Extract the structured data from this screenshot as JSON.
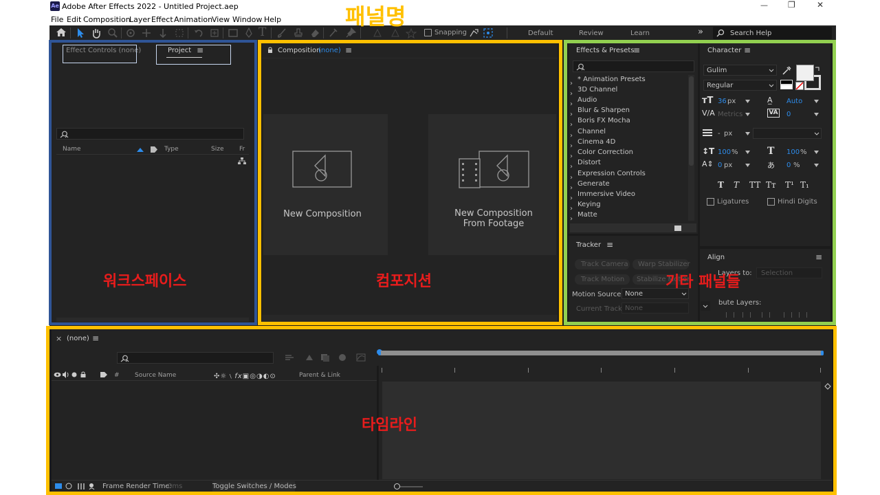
{
  "window": {
    "title": "Adobe After Effects 2022 - Untitled Project.aep",
    "logo": "Ae",
    "controls": [
      "—",
      "❐",
      "✕"
    ]
  },
  "menu": [
    "File",
    "Edit",
    "Composition",
    "Layer",
    "Effect",
    "Animation",
    "View",
    "Window",
    "Help"
  ],
  "toolbar": {
    "snapping_label": "Snapping",
    "workspaces": [
      "Default",
      "Review",
      "Learn"
    ],
    "overflow": "»",
    "search_help": "Search Help"
  },
  "annotations": {
    "panel_name": "패널명",
    "workspace": "워크스페이스",
    "composition": "컴포지션",
    "other_panels": "기타 패널들",
    "timeline": "타임라인"
  },
  "left_panel": {
    "effect_controls_tab": "Effect Controls (none)",
    "project_tab": "Project",
    "menu": "≡",
    "columns": {
      "name": "Name",
      "type": "Type",
      "size": "Size",
      "frame": "Fr"
    }
  },
  "composition_panel": {
    "tab_prefix": "Composition",
    "tab_value": "(none)",
    "menu": "≡",
    "new_comp": "New Composition",
    "new_comp_footage_1": "New Composition",
    "new_comp_footage_2": "From Footage"
  },
  "effects_panel": {
    "title": "Effects & Presets",
    "menu": "≡",
    "items": [
      "* Animation Presets",
      "3D Channel",
      "Audio",
      "Blur & Sharpen",
      "Boris FX Mocha",
      "Channel",
      "Cinema 4D",
      "Color Correction",
      "Distort",
      "Expression Controls",
      "Generate",
      "Immersive Video",
      "Keying",
      "Matte"
    ]
  },
  "tracker_panel": {
    "title": "Tracker",
    "menu": "≡",
    "track_camera": "Track Camera",
    "warp_stabilizer": "Warp Stabilizer",
    "track_motion": "Track Motion",
    "stabilize_motion": "Stabilize Motion",
    "motion_source_label": "Motion Source:",
    "motion_source_value": "None",
    "current_track_label": "Current Track:",
    "current_track_value": "None"
  },
  "character_panel": {
    "title": "Character",
    "menu": "≡",
    "font": "Gulim",
    "style": "Regular",
    "font_size": "36",
    "font_size_unit": "px",
    "leading": "Auto",
    "kerning": "Metrics",
    "tracking": "0",
    "stroke": "-",
    "stroke_unit": "px",
    "vscale": "100",
    "hscale": "100",
    "pct": "%",
    "baseline": "0",
    "baseline_unit": "px",
    "tsume": "0",
    "styles": [
      "T",
      "T",
      "TT",
      "Tᴛ",
      "T¹",
      "T₁"
    ],
    "ligatures": "Ligatures",
    "hindi_digits": "Hindi Digits"
  },
  "align_panel": {
    "title": "Align",
    "menu": "≡",
    "align_to_label": "Layers to:",
    "align_to_value": "Selection",
    "distribute_label": "bute Layers:"
  },
  "timeline": {
    "close": "×",
    "title": "(none)",
    "menu": "≡",
    "column_hash": "#",
    "column_source": "Source Name",
    "column_parent": "Parent & Link",
    "frame_render_label": "Frame Render Time:",
    "frame_render_value": "0ms",
    "toggle": "Toggle Switches / Modes"
  },
  "colors": {
    "blue_box": "#2f5597",
    "yellow_box": "#ffc000",
    "green_box": "#92d050",
    "label_red": "#e81c1c",
    "accent": "#2d8ceb"
  }
}
